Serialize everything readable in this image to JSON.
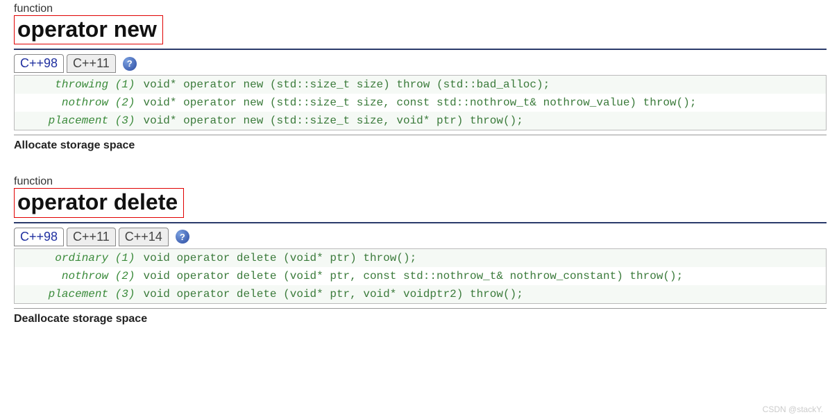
{
  "sections": [
    {
      "kind": "function",
      "title": "operator new",
      "tabs": [
        "C++98",
        "C++11"
      ],
      "activeTab": 0,
      "rows": [
        {
          "label": "throwing (1)",
          "code": "void* operator new (std::size_t size) throw (std::bad_alloc);"
        },
        {
          "label": "nothrow (2)",
          "code": "void* operator new (std::size_t size, const std::nothrow_t& nothrow_value) throw();"
        },
        {
          "label": "placement (3)",
          "code": "void* operator new (std::size_t size, void* ptr) throw();"
        }
      ],
      "desc": "Allocate storage space"
    },
    {
      "kind": "function",
      "title": "operator delete",
      "tabs": [
        "C++98",
        "C++11",
        "C++14"
      ],
      "activeTab": 0,
      "rows": [
        {
          "label": "ordinary (1)",
          "code": "void operator delete (void* ptr) throw();"
        },
        {
          "label": "nothrow (2)",
          "code": "void operator delete (void* ptr, const std::nothrow_t& nothrow_constant) throw();"
        },
        {
          "label": "placement (3)",
          "code": "void operator delete (void* ptr, void* voidptr2) throw();"
        }
      ],
      "desc": "Deallocate storage space"
    }
  ],
  "helpGlyph": "?",
  "watermark": "CSDN @stackY."
}
